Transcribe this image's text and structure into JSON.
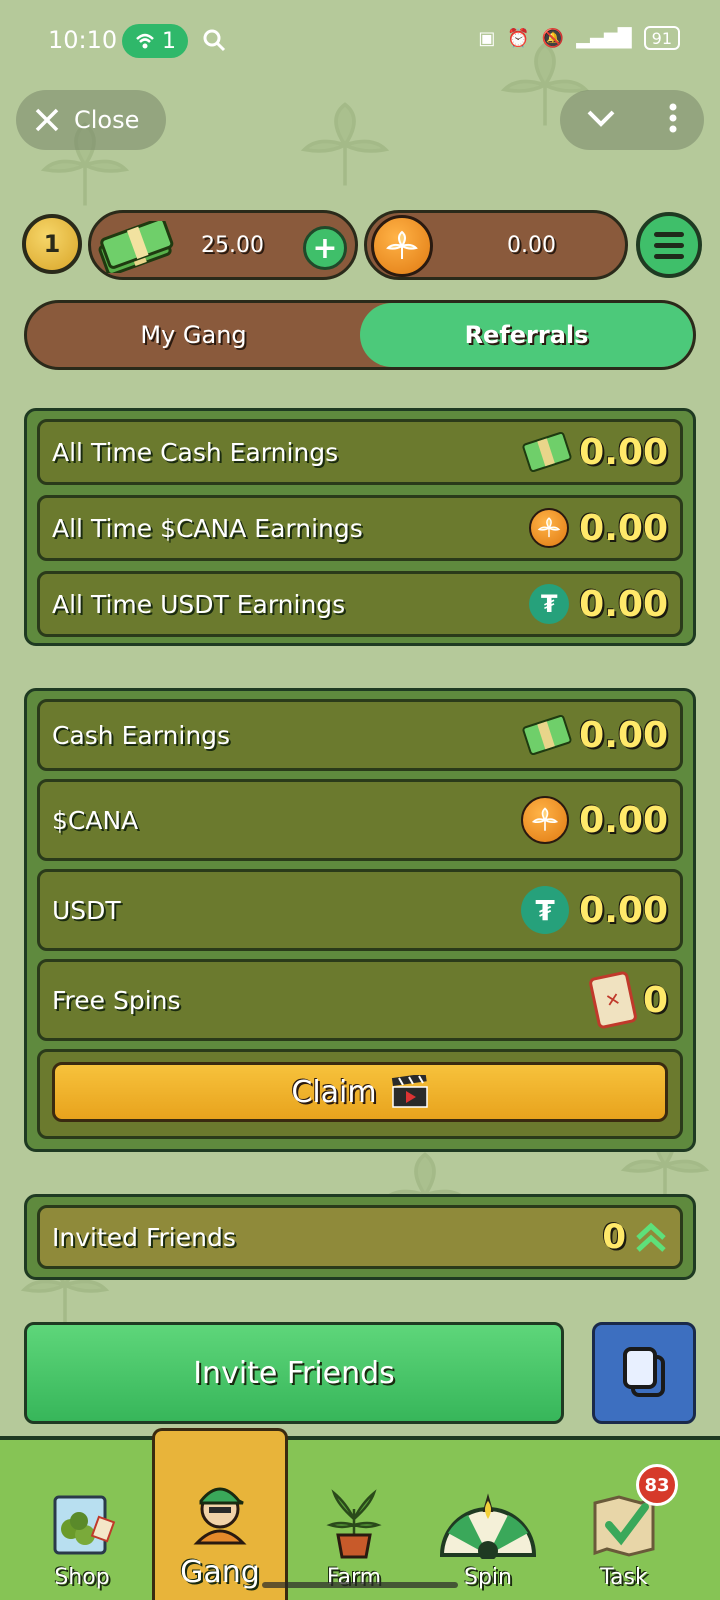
{
  "status_bar": {
    "time": "10:10",
    "hotspot_count": "1",
    "battery": "91"
  },
  "top_nav": {
    "close_label": "Close"
  },
  "balances": {
    "level": "1",
    "cash": "25.00",
    "plus": "+",
    "cana": "0.00"
  },
  "tabs": [
    {
      "label": "My Gang",
      "active": false
    },
    {
      "label": "Referrals",
      "active": true
    }
  ],
  "all_time": [
    {
      "label": "All Time Cash Earnings",
      "icon": "cash-icon",
      "value": "0.00"
    },
    {
      "label": "All Time $CANA Earnings",
      "icon": "cana-coin-icon",
      "value": "0.00"
    },
    {
      "label": "All Time USDT Earnings",
      "icon": "usdt-icon",
      "value": "0.00"
    }
  ],
  "earnings": [
    {
      "label": "Cash Earnings",
      "icon": "cash-icon",
      "value": "0.00"
    },
    {
      "label": "$CANA",
      "icon": "cana-coin-icon",
      "value": "0.00"
    },
    {
      "label": "USDT",
      "icon": "usdt-icon",
      "value": "0.00"
    },
    {
      "label": "Free Spins",
      "icon": "ticket-icon",
      "value": "0"
    }
  ],
  "claim": {
    "label": "Claim",
    "icon": "clapperboard-icon"
  },
  "invited": {
    "label": "Invited Friends",
    "value": "0"
  },
  "invite_button": {
    "label": "Invite Friends"
  },
  "bottom_nav": [
    {
      "label": "Shop",
      "icon": "shop-bag-icon",
      "active": false
    },
    {
      "label": "Gang",
      "icon": "gang-avatar-icon",
      "active": true
    },
    {
      "label": "Farm",
      "icon": "plant-pot-icon",
      "active": false
    },
    {
      "label": "Spin",
      "icon": "spin-wheel-icon",
      "active": false
    },
    {
      "label": "Task",
      "icon": "task-map-icon",
      "active": false,
      "badge": "83"
    }
  ],
  "colors": {
    "accent_green": "#4cc97a",
    "value_yellow": "#ffe96a",
    "claim_orange": "#f7c23c",
    "brown": "#8a5a3c"
  }
}
